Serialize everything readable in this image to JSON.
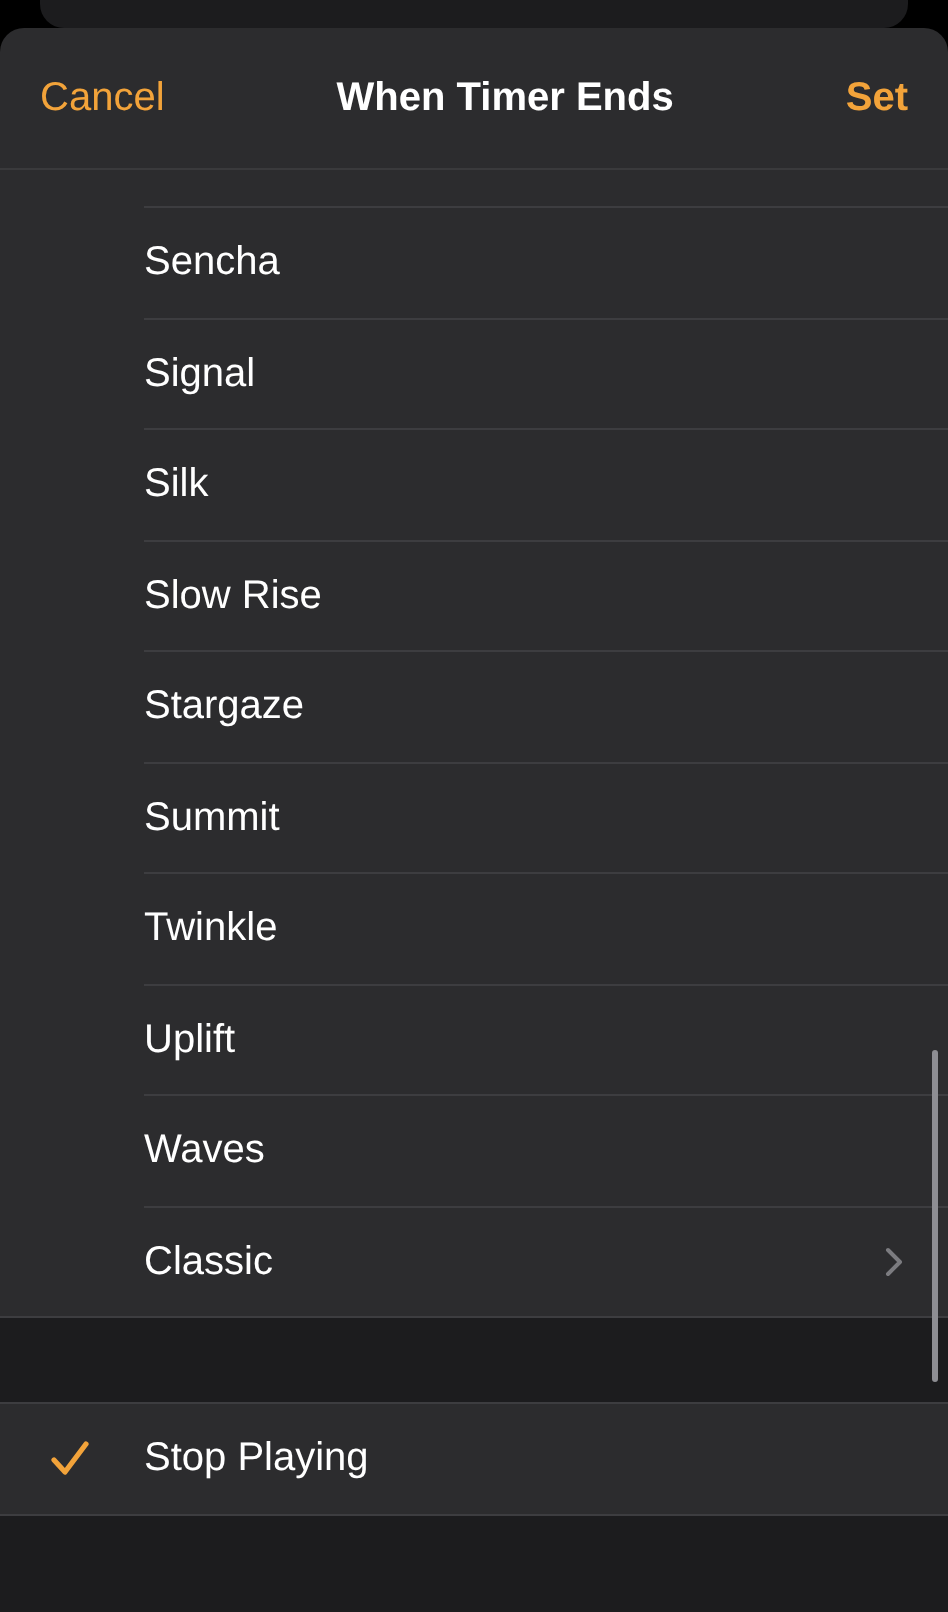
{
  "header": {
    "cancel": "Cancel",
    "title": "When Timer Ends",
    "set": "Set"
  },
  "sounds": [
    {
      "label": "Sencha",
      "kind": "sound",
      "selected": false
    },
    {
      "label": "Signal",
      "kind": "sound",
      "selected": false
    },
    {
      "label": "Silk",
      "kind": "sound",
      "selected": false
    },
    {
      "label": "Slow Rise",
      "kind": "sound",
      "selected": false
    },
    {
      "label": "Stargaze",
      "kind": "sound",
      "selected": false
    },
    {
      "label": "Summit",
      "kind": "sound",
      "selected": false
    },
    {
      "label": "Twinkle",
      "kind": "sound",
      "selected": false
    },
    {
      "label": "Uplift",
      "kind": "sound",
      "selected": false
    },
    {
      "label": "Waves",
      "kind": "sound",
      "selected": false
    },
    {
      "label": "Classic",
      "kind": "submenu",
      "selected": false
    }
  ],
  "actions": [
    {
      "label": "Stop Playing",
      "selected": true
    }
  ]
}
